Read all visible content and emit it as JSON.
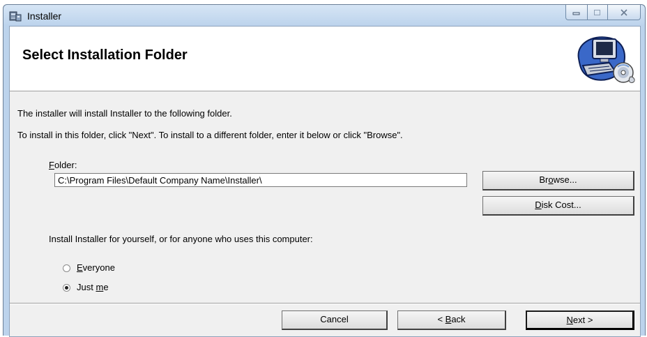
{
  "window": {
    "title": "Installer",
    "controls": {
      "minimize": "minimize-icon",
      "maximize": "maximize-icon",
      "close": "close-icon"
    }
  },
  "banner": {
    "title": "Select Installation Folder",
    "art_icon": "computer-cd-icon"
  },
  "body": {
    "line1": "The installer will install Installer to the following folder.",
    "line2": "To install in this folder, click \"Next\". To install to a different folder, enter it below or click \"Browse\".",
    "folder_label_key": "F",
    "folder_label_rest": "older:",
    "folder_value": "C:\\Program Files\\Default Company Name\\Installer\\",
    "browse_pre": "Br",
    "browse_key": "o",
    "browse_post": "wse...",
    "diskcost_key": "D",
    "diskcost_post": "isk Cost...",
    "scope_prompt": "Install Installer for yourself, or for anyone who uses this computer:",
    "option_everyone_key": "E",
    "option_everyone_rest": "veryone",
    "option_justme_pre": "Just ",
    "option_justme_key": "m",
    "option_justme_post": "e",
    "selected_option": "Just me"
  },
  "footer": {
    "cancel": "Cancel",
    "back_pre": "< ",
    "back_key": "B",
    "back_post": "ack",
    "next_key": "N",
    "next_post": "ext >"
  }
}
